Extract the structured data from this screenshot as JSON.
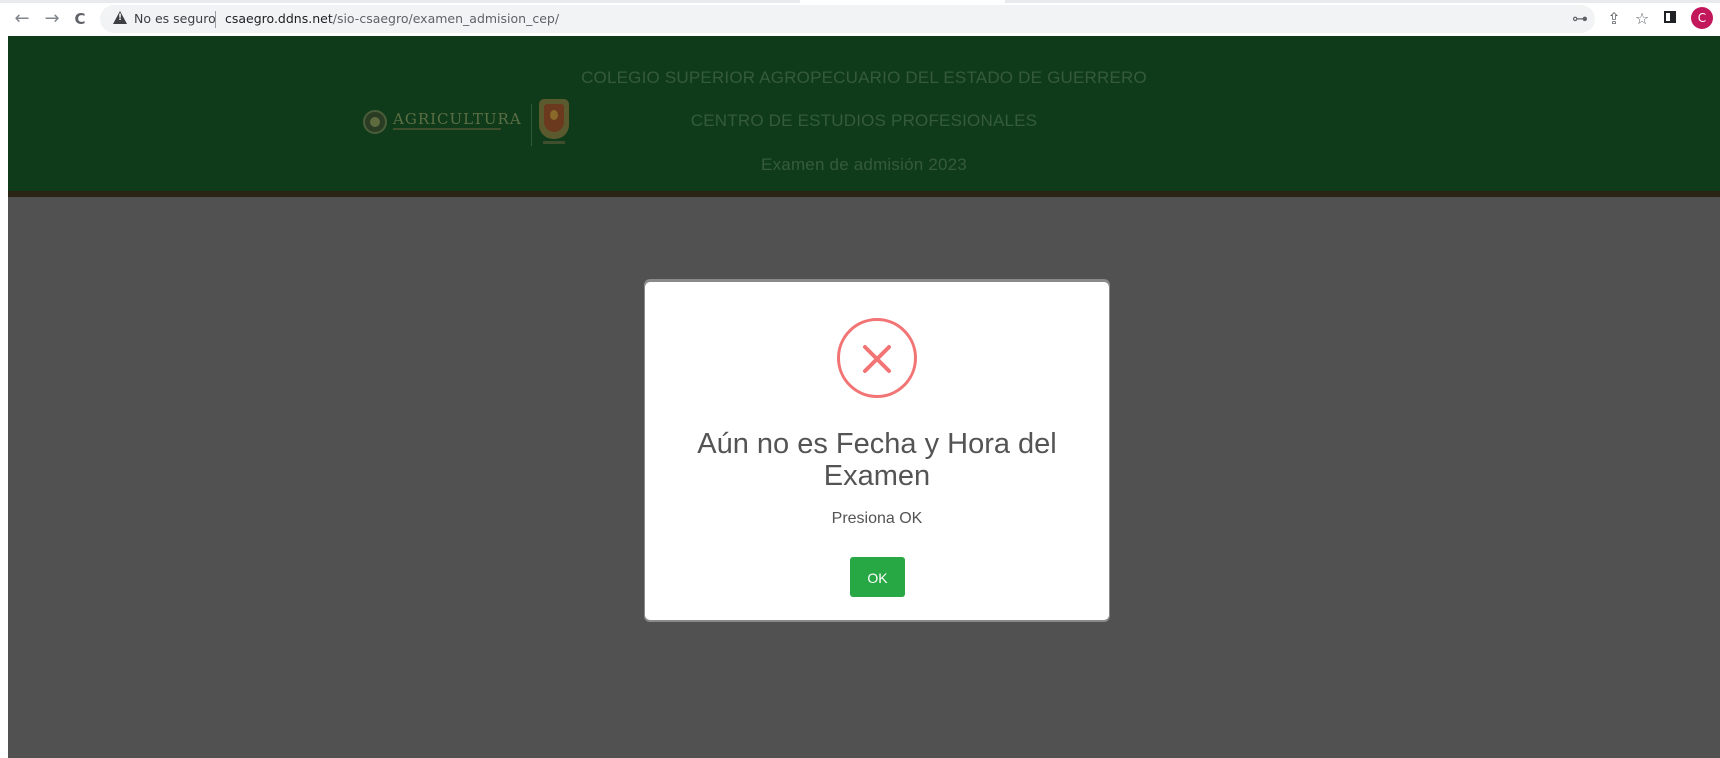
{
  "browser": {
    "back_glyph": "←",
    "forward_glyph": "→",
    "reload_glyph": "C",
    "security_text": "No es seguro",
    "url_host": "csaegro.ddns.net",
    "url_path": "/sio-csaegro/examen_admision_cep/",
    "icons": [
      "back-arrow-icon",
      "forward-arrow-icon",
      "reload-icon",
      "warning-icon",
      "key-icon",
      "share-icon",
      "star-icon",
      "side-panel-icon"
    ],
    "key_glyph": "⊶",
    "share_glyph": "⇪",
    "star_glyph": "☆",
    "profile_initial": "C",
    "profile_color": "#c2185b"
  },
  "header": {
    "line1": "COLEGIO SUPERIOR AGROPECUARIO DEL ESTADO DE GUERRERO",
    "line2": "CENTRO DE ESTUDIOS PROFESIONALES",
    "line3": "Examen de admisión 2023",
    "logo_text": "AGRICULTURA",
    "background_color": "#103b1b"
  },
  "modal": {
    "icon": "error-x-icon",
    "title": "Aún no es Fecha y Hora del Examen",
    "text": "Presiona OK",
    "ok_label": "OK",
    "button_color": "#28a745",
    "icon_color": "#f27474"
  }
}
